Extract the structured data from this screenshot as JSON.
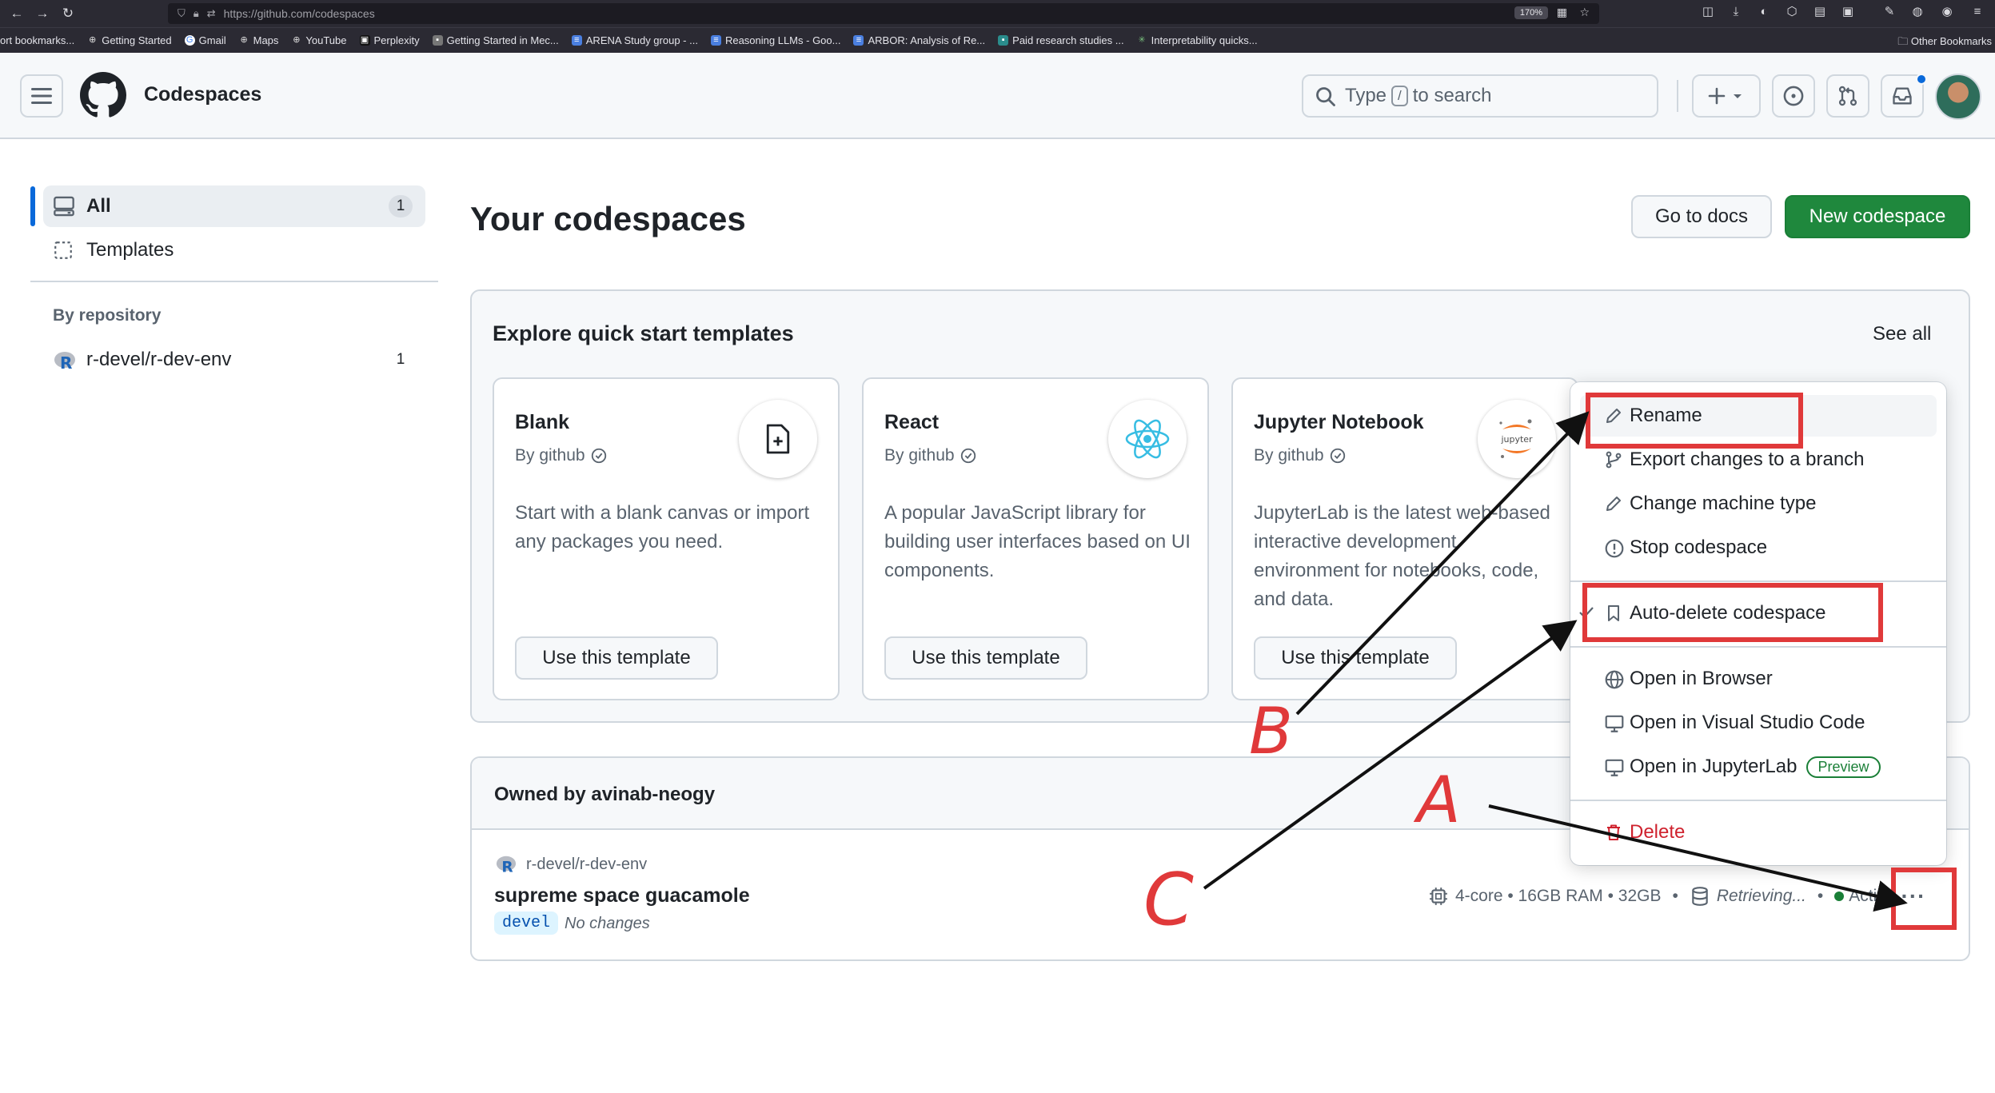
{
  "browser": {
    "url": "https://github.com/codespaces",
    "zoom": "170%",
    "bookmarks": [
      "ort bookmarks...",
      "Getting Started",
      "Gmail",
      "Maps",
      "YouTube",
      "Perplexity",
      "Getting Started in Mec...",
      "ARENA Study group - ...",
      "Reasoning LLMs - Goo...",
      "ARBOR: Analysis of Re...",
      "Paid research studies ...",
      "Interpretability quicks..."
    ],
    "other_bookmarks": "Other Bookmarks"
  },
  "header": {
    "title": "Codespaces",
    "search_prefix": "Type",
    "search_key": "/",
    "search_suffix": "to search"
  },
  "sidebar": {
    "items": [
      {
        "label": "All",
        "count": "1"
      },
      {
        "label": "Templates"
      }
    ],
    "by_repository_heading": "By repository",
    "repos": [
      {
        "label": "r-devel/r-dev-env",
        "count": "1"
      }
    ]
  },
  "main": {
    "title": "Your codespaces",
    "docs_button": "Go to docs",
    "new_button": "New codespace",
    "templates_heading": "Explore quick start templates",
    "see_all": "See all",
    "templates": [
      {
        "name": "Blank",
        "by": "By github",
        "desc": "Start with a blank canvas or import any packages you need.",
        "button": "Use this template"
      },
      {
        "name": "React",
        "by": "By github",
        "desc": "A popular JavaScript library for building user interfaces based on UI components.",
        "button": "Use this template"
      },
      {
        "name": "Jupyter Notebook",
        "by": "By github",
        "desc": "JupyterLab is the latest web-based interactive development environment for notebooks, code, and data.",
        "button": "Use this template",
        "icon_text": "jupyter"
      }
    ],
    "owned_heading": "Owned by avinab-neogy",
    "codespace": {
      "repo": "r-devel/r-dev-env",
      "name": "supreme space guacamole",
      "branch": "devel",
      "changes": "No changes",
      "machine": "4-core • 16GB RAM • 32GB",
      "storage": "Retrieving...",
      "status": "Active",
      "menu_trigger": "···"
    }
  },
  "menu": {
    "items": [
      "Rename",
      "Export changes to a branch",
      "Change machine type",
      "Stop codespace",
      "Auto-delete codespace",
      "Open in Browser",
      "Open in Visual Studio Code",
      "Open in JupyterLab",
      "Delete"
    ],
    "preview_badge": "Preview"
  },
  "annotations": {
    "labels": [
      "A",
      "B",
      "C"
    ],
    "color": "#e0393a"
  },
  "colors": {
    "primary_green": "#1f883d",
    "accent_blue": "#0969da",
    "danger_red": "#cf222e",
    "annotation_red": "#e0393a"
  }
}
